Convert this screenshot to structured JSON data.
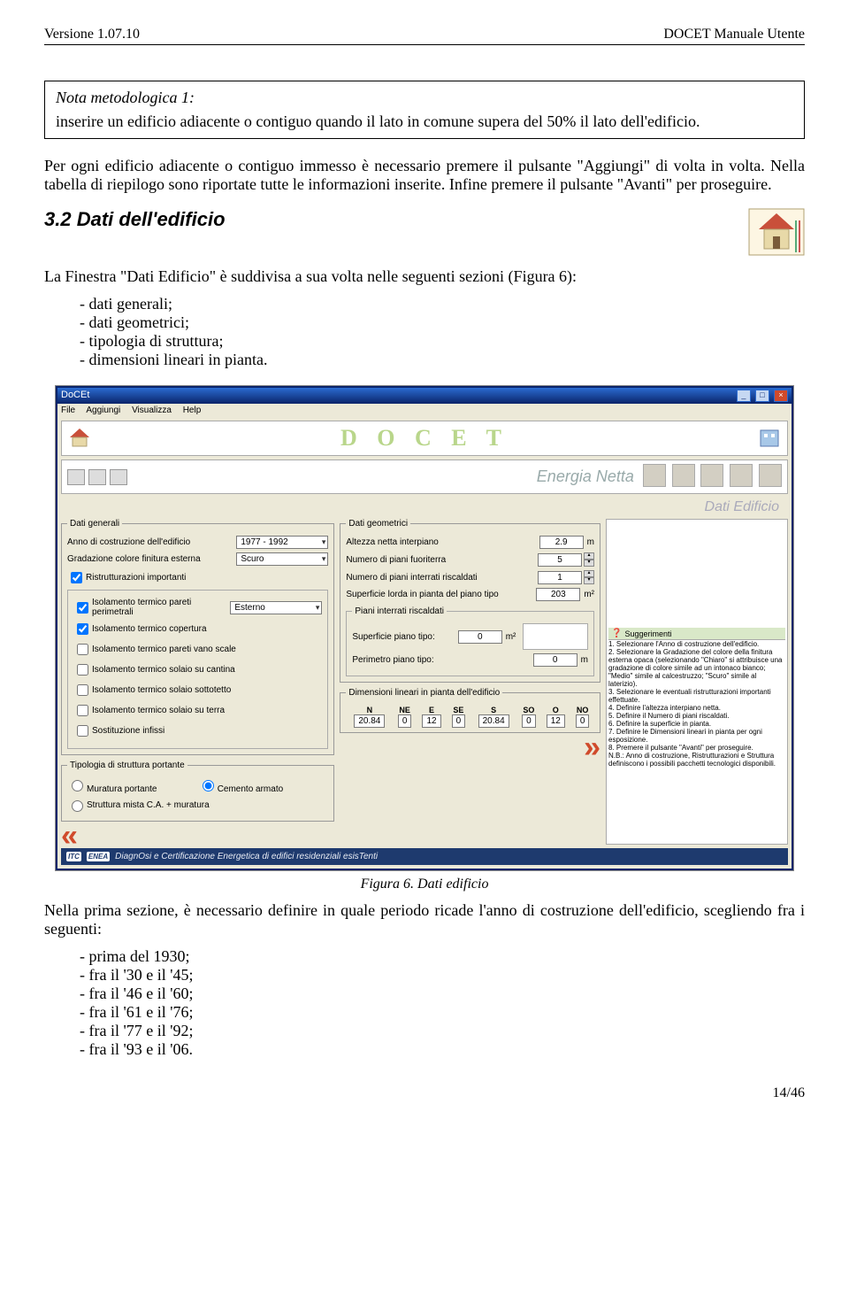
{
  "header": {
    "left": "Versione 1.07.10",
    "right": "DOCET Manuale Utente"
  },
  "note": {
    "title": "Nota metodologica 1:",
    "body": "inserire un edificio adiacente o contiguo quando il lato in comune supera del 50% il lato dell'edificio."
  },
  "para1": "Per ogni edificio adiacente o contiguo immesso è necessario premere il pulsante \"Aggiungi\" di volta in volta. Nella tabella di riepilogo sono riportate tutte le informazioni inserite. Infine premere il pulsante \"Avanti\" per proseguire.",
  "section_heading": "3.2  Dati dell'edificio",
  "para2": "La Finestra \"Dati Edificio\" è suddivisa a sua volta nelle seguenti sezioni (Figura 6):",
  "sections_list": [
    "dati generali;",
    "dati geometrici;",
    "tipologia di struttura;",
    "dimensioni lineari in pianta."
  ],
  "app": {
    "title": "DoCEt",
    "menu": [
      "File",
      "Aggiungi",
      "Visualizza",
      "Help"
    ],
    "logo": "D O C E T",
    "tab_label": "Energia Netta",
    "subtitle": "Dati Edificio",
    "legend_generali": "Dati generali",
    "legend_geom": "Dati geometrici",
    "legend_tip": "Tipologia di struttura portante",
    "legend_dim": "Dimensioni lineari in pianta dell'edificio",
    "legend_piani": "Piani interrati riscaldati",
    "lab_anno": "Anno di costruzione dell'edificio",
    "val_anno": "1977 - 1992",
    "lab_grad": "Gradazione colore finitura esterna",
    "val_grad": "Scuro",
    "chk_ristr": "Ristrutturazioni importanti",
    "ristr_items": [
      "Isolamento termico pareti perimetrali",
      "Isolamento termico copertura",
      "Isolamento termico pareti vano scale",
      "Isolamento termico solaio su cantina",
      "Isolamento termico solaio sottotetto",
      "Isolamento termico solaio su terra",
      "Sostituzione infissi"
    ],
    "ristr_checked": [
      true,
      true,
      false,
      false,
      false,
      false,
      false
    ],
    "val_esterno": "Esterno",
    "lab_alt": "Altezza netta interpiano",
    "val_alt": "2.9",
    "unit_m": "m",
    "lab_piani_ft": "Numero di piani fuoriterra",
    "val_piani_ft": "5",
    "lab_piani_int": "Numero di piani interrati riscaldati",
    "val_piani_int": "1",
    "lab_sup_lorda": "Superficie lorda in pianta del piano tipo",
    "val_sup_lorda": "203",
    "unit_m2": "m²",
    "lab_sup_tipo": "Superficie piano tipo:",
    "val_sup_tipo": "0",
    "lab_per_tipo": "Perimetro piano tipo:",
    "val_per_tipo": "0",
    "rad_mur": "Muratura portante",
    "rad_cem": "Cemento armato",
    "rad_mix": "Struttura mista C.A. + muratura",
    "dim_headers": [
      "N",
      "NE",
      "E",
      "SE",
      "S",
      "SO",
      "O",
      "NO"
    ],
    "dim_values": [
      "20.84",
      "0",
      "12",
      "0",
      "20.84",
      "0",
      "12",
      "0"
    ],
    "footer_text": "DiagnOsi e Certificazione Energetica di edifici residenziali esisTenti",
    "footer_logos": [
      "ITC",
      "ENEA"
    ],
    "sugg_title": "Suggerimenti",
    "sugg": [
      "1. Selezionare l'Anno di costruzione dell'edificio.",
      "2. Selezionare la Gradazione del colore della finitura esterna opaca (selezionando \"Chiaro\" si attribuisce una gradazione di colore simile ad un intonaco bianco; \"Medio\" simile al calcestruzzo; \"Scuro\" simile al laterizio).",
      "3. Selezionare le eventuali ristrutturazioni importanti effettuate.",
      "4. Definire l'altezza interpiano netta.",
      "5. Definire il Numero di piani riscaldati.",
      "6. Definire la superficie in pianta.",
      "7. Definire le Dimensioni lineari in pianta per ogni esposizione.",
      "8. Premere il pulsante \"Avanti\" per proseguire.",
      "N.B.: Anno di costruzione, Ristrutturazioni e Struttura definiscono i possibili pacchetti tecnologici disponibili."
    ]
  },
  "fig_caption": "Figura 6. Dati edificio",
  "para3": "Nella prima sezione, è necessario definire in quale periodo ricade l'anno di costruzione dell'edificio, scegliendo fra i seguenti:",
  "periods": [
    "prima del 1930;",
    "fra il '30 e il '45;",
    "fra il '46 e il '60;",
    "fra il '61 e il '76;",
    "fra il '77 e il '92;",
    "fra il '93 e il '06."
  ],
  "page_footer": "14/46"
}
